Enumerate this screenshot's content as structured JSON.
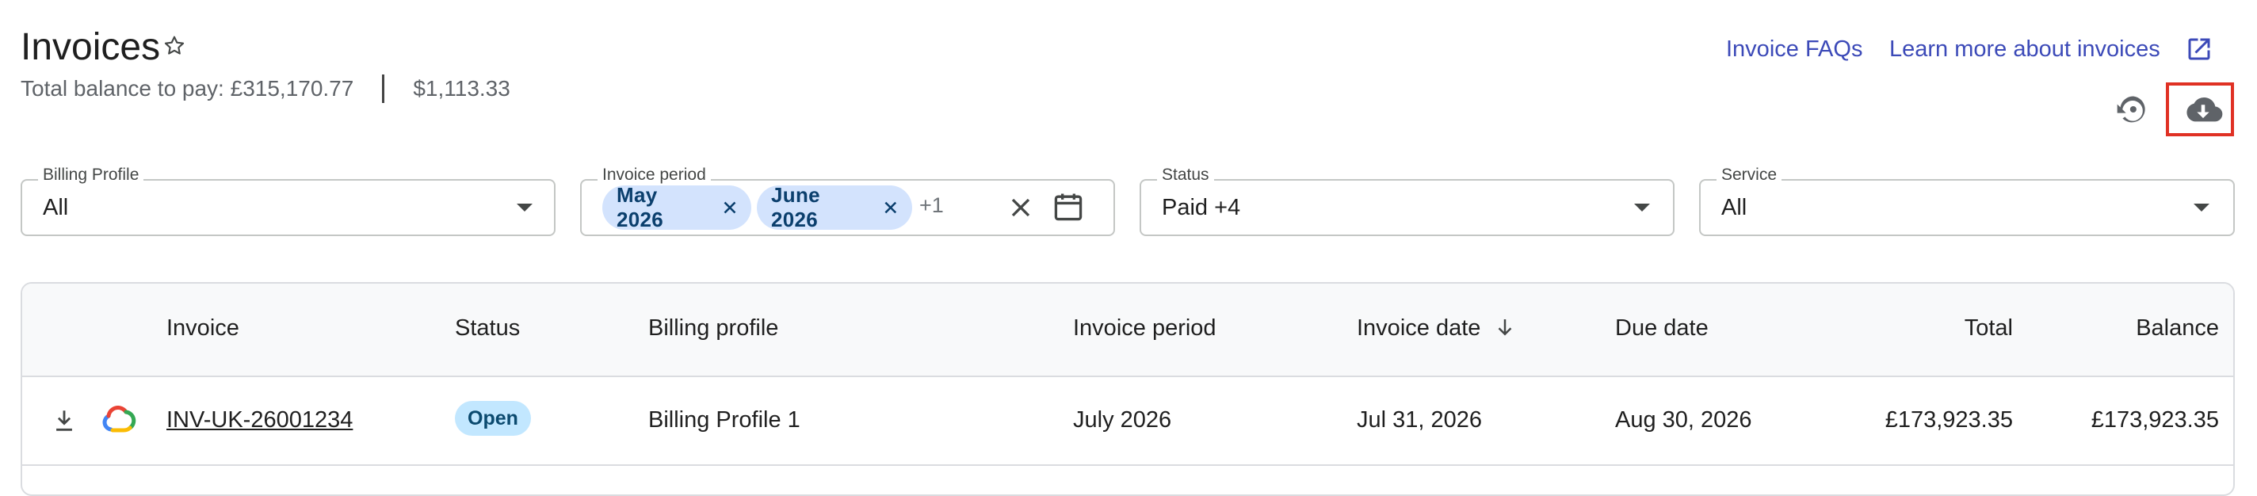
{
  "header": {
    "title": "Invoices",
    "total_balance": "Total balance to pay: £315,170.77",
    "usd_balance": "$1,113.33",
    "faq_link": "Invoice FAQs",
    "learn_link": "Learn more about invoices"
  },
  "filters": {
    "billing_profile": {
      "label": "Billing Profile",
      "value": "All"
    },
    "invoice_period": {
      "label": "Invoice period",
      "chips": [
        "May 2026",
        "June 2026"
      ],
      "more": "+1"
    },
    "status": {
      "label": "Status",
      "value": "Paid +4"
    },
    "service": {
      "label": "Service",
      "value": "All"
    }
  },
  "table": {
    "columns": {
      "invoice": "Invoice",
      "status": "Status",
      "billing_profile": "Billing profile",
      "invoice_period": "Invoice period",
      "invoice_date": "Invoice date",
      "due_date": "Due date",
      "total": "Total",
      "balance": "Balance"
    },
    "rows": [
      {
        "invoice": "INV-UK-26001234",
        "status": "Open",
        "billing_profile": "Billing Profile 1",
        "invoice_period": "July 2026",
        "invoice_date": "Jul 31, 2026",
        "due_date": "Aug 30, 2026",
        "total": "£173,923.35",
        "balance": "£173,923.35"
      }
    ]
  },
  "colors": {
    "link": "#3c4ab8",
    "chip_bg": "#d3e3fd",
    "badge_bg": "#c2e7ff",
    "highlight_box": "#e03124"
  },
  "icons": [
    "star-icon",
    "external-link-icon",
    "reset-icon",
    "cloud-download-icon",
    "close-icon",
    "calendar-icon",
    "dropdown-arrow-icon",
    "sort-arrow-down-icon",
    "download-icon",
    "google-cloud-logo"
  ]
}
